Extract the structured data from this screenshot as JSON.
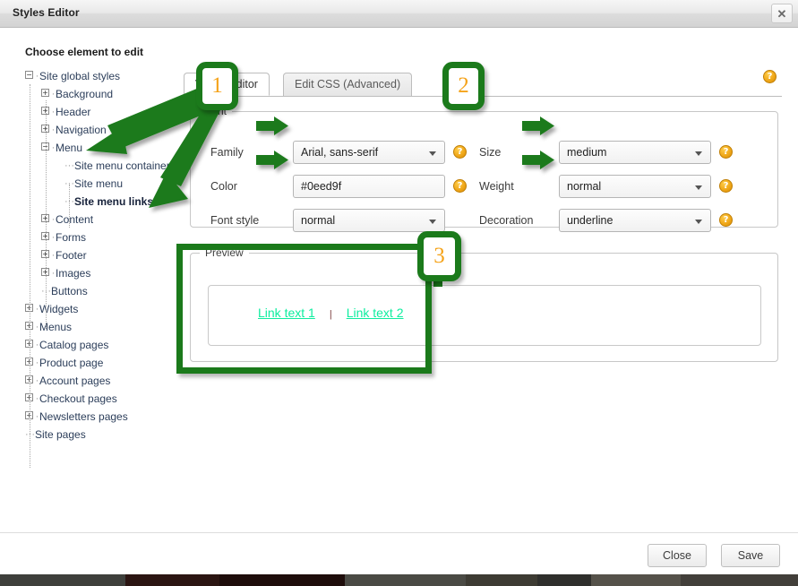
{
  "window": {
    "title": "Styles Editor",
    "close_icon": "close-x-icon"
  },
  "tree": {
    "heading": "Choose element to edit",
    "items": [
      {
        "label": "Site global styles",
        "level": 0,
        "toggle": "minus",
        "bold": false
      },
      {
        "label": "Background",
        "level": 1,
        "toggle": "plus",
        "bold": false
      },
      {
        "label": "Header",
        "level": 1,
        "toggle": "plus",
        "bold": false
      },
      {
        "label": "Navigation",
        "level": 1,
        "toggle": "plus",
        "bold": false
      },
      {
        "label": "Menu",
        "level": 1,
        "toggle": "minus",
        "bold": false
      },
      {
        "label": "Site menu container",
        "level": 2,
        "toggle": "leaf",
        "bold": false
      },
      {
        "label": "Site menu",
        "level": 2,
        "toggle": "leaf",
        "bold": false
      },
      {
        "label": "Site menu links",
        "level": 2,
        "toggle": "leaf",
        "bold": true
      },
      {
        "label": "Content",
        "level": 1,
        "toggle": "plus",
        "bold": false
      },
      {
        "label": "Forms",
        "level": 1,
        "toggle": "plus",
        "bold": false
      },
      {
        "label": "Footer",
        "level": 1,
        "toggle": "plus",
        "bold": false
      },
      {
        "label": "Images",
        "level": 1,
        "toggle": "plus",
        "bold": false
      },
      {
        "label": "Buttons",
        "level": 1,
        "toggle": "leaf",
        "bold": false
      },
      {
        "label": "Widgets",
        "level": 0,
        "toggle": "plus",
        "bold": false
      },
      {
        "label": "Menus",
        "level": 0,
        "toggle": "plus",
        "bold": false
      },
      {
        "label": "Catalog pages",
        "level": 0,
        "toggle": "plus",
        "bold": false
      },
      {
        "label": "Product page",
        "level": 0,
        "toggle": "plus",
        "bold": false
      },
      {
        "label": "Account pages",
        "level": 0,
        "toggle": "plus",
        "bold": false
      },
      {
        "label": "Checkout pages",
        "level": 0,
        "toggle": "plus",
        "bold": false
      },
      {
        "label": "Newsletters pages",
        "level": 0,
        "toggle": "plus",
        "bold": false
      },
      {
        "label": "Site pages",
        "level": 0,
        "toggle": "leaf",
        "bold": false
      }
    ]
  },
  "tabs": [
    {
      "label": "Visual Editor",
      "active": true
    },
    {
      "label": "Edit CSS (Advanced)",
      "active": false
    }
  ],
  "font_panel": {
    "legend": "Font",
    "fields": {
      "family": {
        "label": "Family",
        "value": "Arial, sans-serif",
        "control": "select"
      },
      "color": {
        "label": "Color",
        "value": "#0eed9f",
        "control": "text"
      },
      "font_style": {
        "label": "Font style",
        "value": "normal",
        "control": "select"
      },
      "size": {
        "label": "Size",
        "value": "medium",
        "control": "select"
      },
      "weight": {
        "label": "Weight",
        "value": "normal",
        "control": "select"
      },
      "decoration": {
        "label": "Decoration",
        "value": "underline",
        "control": "select"
      }
    },
    "help_icon": "?"
  },
  "preview_panel": {
    "legend": "Preview",
    "link1": "Link text 1",
    "separator": "|",
    "link2": "Link text 2",
    "link_color": "#0eed9f"
  },
  "footer": {
    "close_label": "Close",
    "save_label": "Save"
  },
  "annotations": {
    "callout1": "1",
    "callout2": "2",
    "callout3": "3",
    "accent_green": "#1b7a1b",
    "number_orange": "#f5a31a"
  }
}
